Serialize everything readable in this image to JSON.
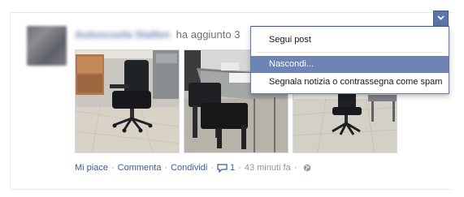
{
  "story": {
    "author_name": "Autoscuola Stallen",
    "action_text": "ha aggiunto 3"
  },
  "footer": {
    "like_label": "Mi piace",
    "comment_label": "Commenta",
    "share_label": "Condividi",
    "separator": "·",
    "comment_count": "1",
    "time_ago": "43 minuti fa",
    "icons": {
      "comment": "comment-bubble-icon",
      "privacy": "globe-icon"
    }
  },
  "menu": {
    "items": [
      {
        "label": "Segui post"
      },
      {
        "label": "Nascondi..."
      },
      {
        "label": "Segnala notizia o contrassegna come spam"
      }
    ],
    "highlighted_index": 1
  },
  "colors": {
    "link": "#3b5998",
    "menu_highlight": "#6d84b4",
    "chevron_button": "#5b75a8"
  }
}
